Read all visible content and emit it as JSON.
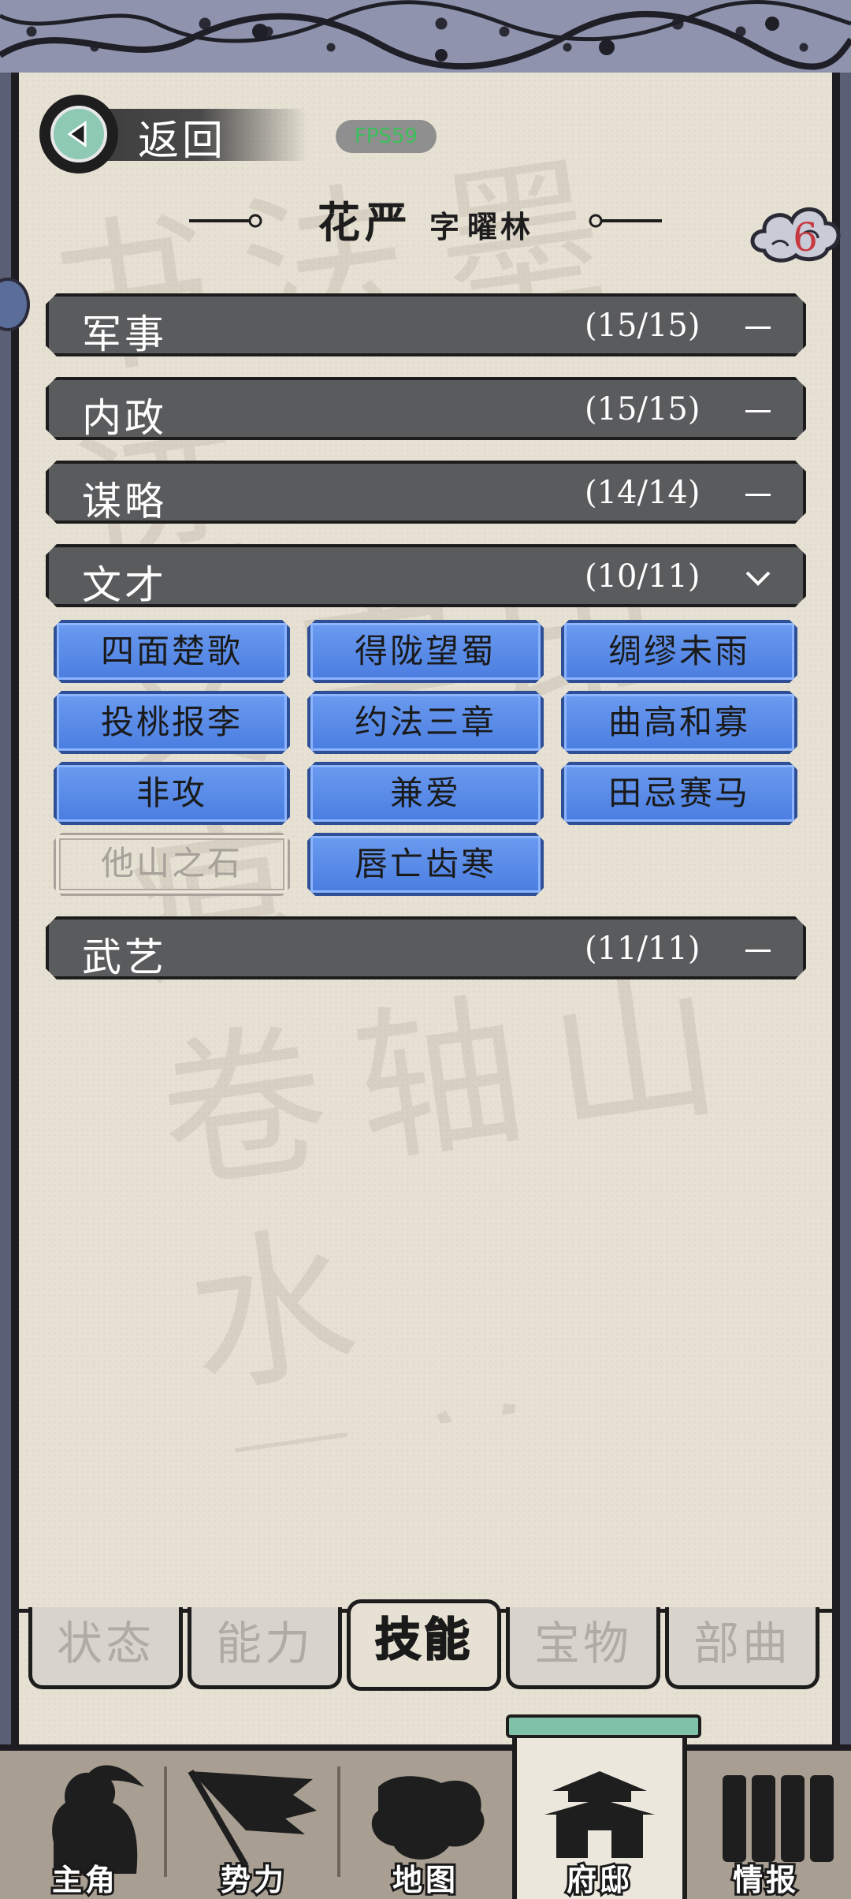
{
  "header": {
    "back_label": "返回",
    "fps": "FPS59"
  },
  "character": {
    "name": "花严",
    "zi_label": "字",
    "courtesy_name": "曜林"
  },
  "badge": {
    "count": "6"
  },
  "categories": [
    {
      "name": "军事",
      "count": "(15/15)",
      "state": "collapsed",
      "icon": "dash-icon"
    },
    {
      "name": "内政",
      "count": "(15/15)",
      "state": "collapsed",
      "icon": "dash-icon"
    },
    {
      "name": "谋略",
      "count": "(14/14)",
      "state": "collapsed",
      "icon": "dash-icon"
    },
    {
      "name": "文才",
      "count": "(10/11)",
      "state": "expanded",
      "icon": "chevron-down-icon"
    },
    {
      "name": "武艺",
      "count": "(11/11)",
      "state": "collapsed",
      "icon": "dash-icon"
    }
  ],
  "skills": [
    {
      "label": "四面楚歌",
      "learned": true
    },
    {
      "label": "得陇望蜀",
      "learned": true
    },
    {
      "label": "绸缪未雨",
      "learned": true
    },
    {
      "label": "投桃报李",
      "learned": true
    },
    {
      "label": "约法三章",
      "learned": true
    },
    {
      "label": "曲高和寡",
      "learned": true
    },
    {
      "label": "非攻",
      "learned": true
    },
    {
      "label": "兼爱",
      "learned": true
    },
    {
      "label": "田忌赛马",
      "learned": true
    },
    {
      "label": "他山之石",
      "learned": false
    },
    {
      "label": "唇亡齿寒",
      "learned": true
    }
  ],
  "sub_tabs": [
    {
      "label": "状态",
      "active": false
    },
    {
      "label": "能力",
      "active": false
    },
    {
      "label": "技能",
      "active": true
    },
    {
      "label": "宝物",
      "active": false
    },
    {
      "label": "部曲",
      "active": false
    }
  ],
  "bottom_nav": [
    {
      "label": "主角",
      "icon": "warrior-icon",
      "active": false
    },
    {
      "label": "势力",
      "icon": "flag-icon",
      "active": false
    },
    {
      "label": "地图",
      "icon": "map-icon",
      "active": false
    },
    {
      "label": "府邸",
      "icon": "mansion-icon",
      "active": true
    },
    {
      "label": "情报",
      "icon": "scroll-icon",
      "active": false
    }
  ],
  "colors": {
    "skill_blue": "#5b8ef0",
    "category_gray": "#5a5b5d",
    "paper": "#e6e1d3",
    "badge_red": "#c8383f",
    "fps_green": "#3cbf5a"
  }
}
